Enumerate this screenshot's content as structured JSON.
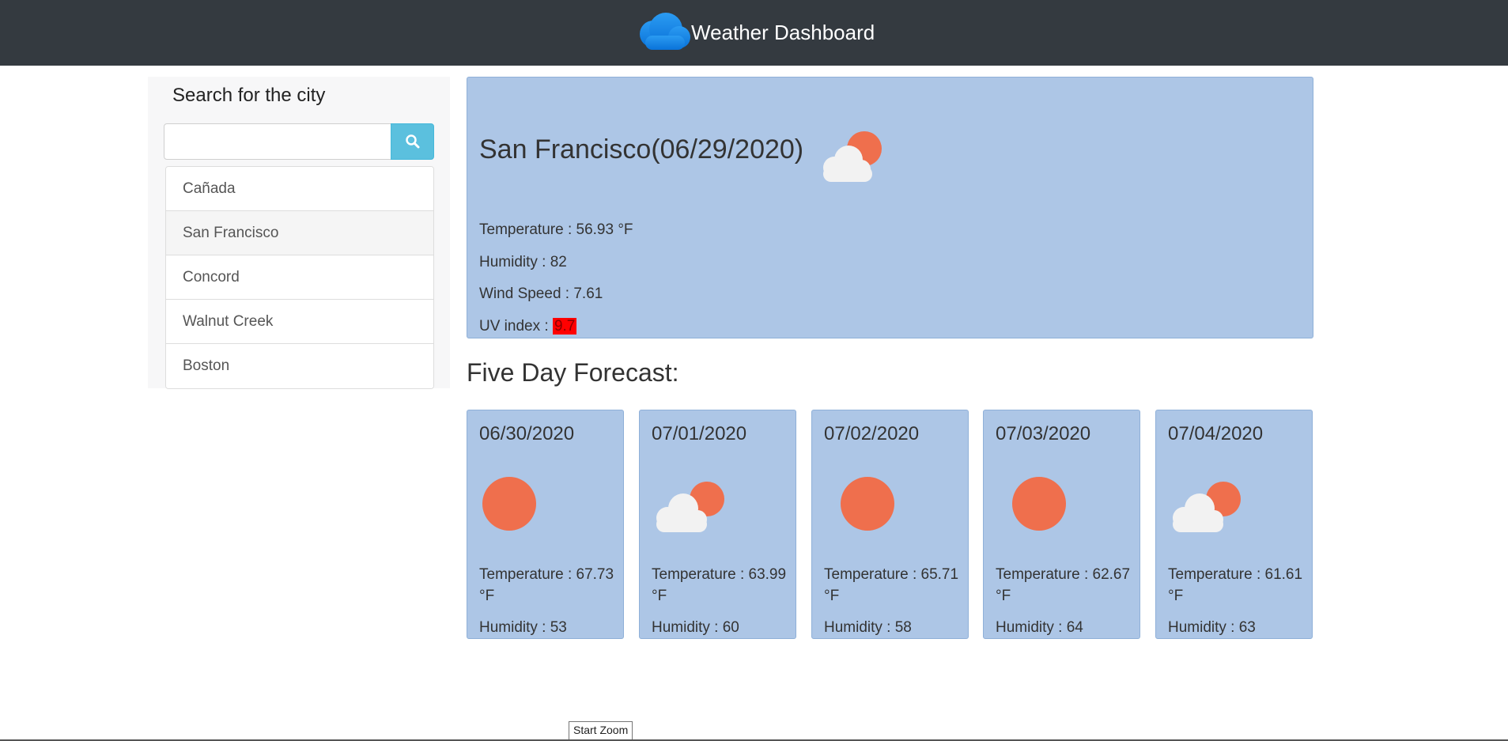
{
  "header": {
    "title": "Weather Dashboard",
    "logo_icon": "cloud-icon",
    "background": "#343a40"
  },
  "sidebar": {
    "title": "Search for the city",
    "search": {
      "value": "",
      "placeholder": ""
    },
    "search_button_icon": "search-icon",
    "cities": [
      {
        "label": "Cañada",
        "active": false
      },
      {
        "label": "San Francisco",
        "active": true
      },
      {
        "label": "Concord",
        "active": false
      },
      {
        "label": "Walnut Creek",
        "active": false
      },
      {
        "label": "Boston",
        "active": false
      }
    ]
  },
  "current": {
    "title": "San Francisco(06/29/2020)",
    "icon": "partly-cloudy-icon",
    "temperature": "Temperature : 56.93 °F",
    "humidity": "Humidity : 82",
    "wind": "Wind Speed : 7.61",
    "uv_label": "UV index : ",
    "uv_value": "9.7",
    "uv_color": "#ff0000"
  },
  "forecast": {
    "title": "Five Day Forecast:",
    "days": [
      {
        "date": "06/30/2020",
        "icon": "sun-icon",
        "temperature": "Temperature : 67.73 °F",
        "humidity": "Humidity : 53"
      },
      {
        "date": "07/01/2020",
        "icon": "partly-cloudy-icon",
        "temperature": "Temperature : 63.99 °F",
        "humidity": "Humidity : 60"
      },
      {
        "date": "07/02/2020",
        "icon": "sun-icon",
        "temperature": "Temperature : 65.71 °F",
        "humidity": "Humidity : 58"
      },
      {
        "date": "07/03/2020",
        "icon": "sun-icon",
        "temperature": "Temperature : 62.67 °F",
        "humidity": "Humidity : 64"
      },
      {
        "date": "07/04/2020",
        "icon": "partly-cloudy-icon",
        "temperature": "Temperature : 61.61 °F",
        "humidity": "Humidity : 63"
      }
    ]
  },
  "tooltip": {
    "label": "Start Zoom"
  },
  "colors": {
    "card": "#adc6e6",
    "accent_button": "#5bc0de",
    "sun": "#ef6f4d",
    "cloud": "#f2f2f2"
  }
}
